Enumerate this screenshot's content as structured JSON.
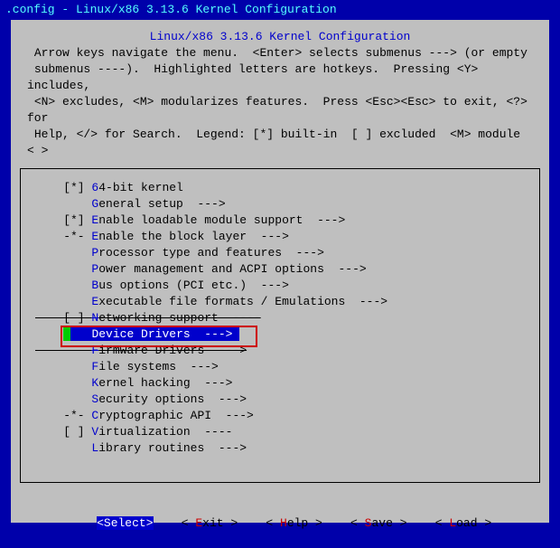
{
  "window_title": ".config - Linux/x86 3.13.6 Kernel Configuration",
  "header": {
    "title": "Linux/x86 3.13.6 Kernel Configuration",
    "help": " Arrow keys navigate the menu.  <Enter> selects submenus ---> (or empty\n submenus ----).  Highlighted letters are hotkeys.  Pressing <Y> includes,\n <N> excludes, <M> modularizes features.  Press <Esc><Esc> to exit, <?> for\n Help, </> for Search.  Legend: [*] built-in  [ ] excluded  <M> module  < >"
  },
  "menu": {
    "items": [
      {
        "prefix": "[*] ",
        "hk": "6",
        "rest": "4-bit kernel",
        "arrow": ""
      },
      {
        "prefix": "    ",
        "hk": "G",
        "rest": "eneral setup  --->",
        "arrow": ""
      },
      {
        "prefix": "[*] ",
        "hk": "E",
        "rest": "nable loadable module support  --->",
        "arrow": ""
      },
      {
        "prefix": "-*- ",
        "hk": "E",
        "rest": "nable the block layer  --->",
        "arrow": ""
      },
      {
        "prefix": "    ",
        "hk": "P",
        "rest": "rocessor type and features  --->",
        "arrow": ""
      },
      {
        "prefix": "    ",
        "hk": "P",
        "rest": "ower management and ACPI options  --->",
        "arrow": ""
      },
      {
        "prefix": "    ",
        "hk": "B",
        "rest": "us options (PCI etc.)  --->",
        "arrow": ""
      },
      {
        "prefix": "    ",
        "hk": "E",
        "rest": "xecutable file formats / Emulations  --->",
        "arrow": ""
      },
      {
        "prefix": "[ ] ",
        "hk": "N",
        "rest": "etworking support  ----",
        "arrow": "",
        "strike": true
      },
      {
        "prefix": "    ",
        "hk": "D",
        "rest": "evice Drivers  --->",
        "arrow": "",
        "selected": true
      },
      {
        "prefix": "    ",
        "hk": "F",
        "rest": "irmware Drivers  --->",
        "arrow": "",
        "strike": true
      },
      {
        "prefix": "    ",
        "hk": "F",
        "rest": "ile systems  --->",
        "arrow": ""
      },
      {
        "prefix": "    ",
        "hk": "K",
        "rest": "ernel hacking  --->",
        "arrow": ""
      },
      {
        "prefix": "    ",
        "hk": "S",
        "rest": "ecurity options  --->",
        "arrow": ""
      },
      {
        "prefix": "-*- ",
        "hk": "C",
        "rest": "ryptographic API  --->",
        "arrow": ""
      },
      {
        "prefix": "[ ] ",
        "hk": "V",
        "rest": "irtualization  ----",
        "arrow": ""
      },
      {
        "prefix": "    ",
        "hk": "L",
        "rest": "ibrary routines  --->",
        "arrow": ""
      }
    ]
  },
  "buttons": {
    "select": {
      "before": "<",
      "hk": "S",
      "rest": "elect>"
    },
    "exit": {
      "before": "< ",
      "hk": "E",
      "rest": "xit >"
    },
    "help": {
      "before": "< ",
      "hk": "H",
      "rest": "elp >"
    },
    "save": {
      "before": "< ",
      "hk": "S",
      "rest": "ave >"
    },
    "load": {
      "before": "< ",
      "hk": "L",
      "rest": "oad >"
    }
  }
}
